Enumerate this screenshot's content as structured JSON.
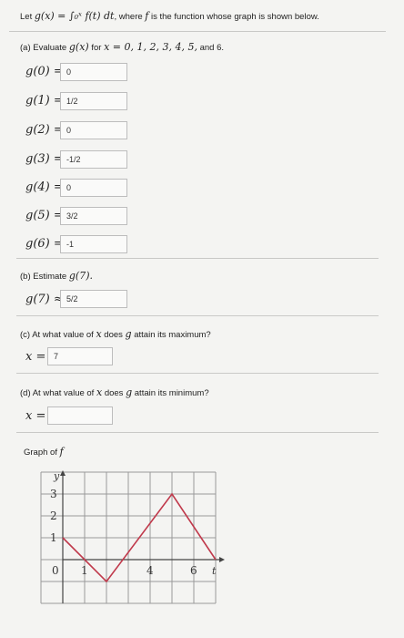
{
  "question": {
    "prefix": "Let",
    "formula": "g(x) = ∫₀ˣ f(t) dt",
    "suffix_pre": ", where",
    "suffix_f": "f",
    "suffix_post": "is the function whose graph is shown below."
  },
  "part_a": {
    "label": "(a) Evaluate",
    "expr": "g(x)",
    "for_text": "for",
    "values_text": "x = 0, 1, 2, 3, 4, 5,",
    "and_text": "and 6.",
    "rows": [
      {
        "label": "g(0) =",
        "answer": "0"
      },
      {
        "label": "g(1) =",
        "answer": "1/2"
      },
      {
        "label": "g(2) =",
        "answer": "0"
      },
      {
        "label": "g(3) =",
        "answer": "-1/2"
      },
      {
        "label": "g(4) =",
        "answer": "0"
      },
      {
        "label": "g(5) =",
        "answer": "3/2"
      },
      {
        "label": "g(6) =",
        "answer": "-1"
      }
    ]
  },
  "part_b": {
    "label": "(b) Estimate",
    "expr": "g(7).",
    "row_label": "g(7) ≈",
    "answer": "5/2"
  },
  "part_c": {
    "text_pre": "(c) At what value of",
    "x": "x",
    "text_mid": "does",
    "g": "g",
    "text_post": "attain its maximum?",
    "row_label": "x =",
    "answer": "7"
  },
  "part_d": {
    "text_pre": "(d) At what value of",
    "x": "x",
    "text_mid": "does",
    "g": "g",
    "text_post": "attain its minimum?",
    "row_label": "x =",
    "answer": ""
  },
  "graph": {
    "title": "Graph of",
    "title_f": "f",
    "y_axis_label": "y",
    "t_axis_label": "t",
    "y_ticks": [
      "3",
      "2",
      "1"
    ],
    "x_ticks": [
      "0",
      "1",
      "4",
      "6"
    ],
    "x_range": [
      -1,
      7
    ],
    "y_range": [
      -2,
      4
    ],
    "curve_color": "#c0394b",
    "curve_points": [
      [
        0,
        1
      ],
      [
        2,
        -1
      ],
      [
        5,
        3
      ],
      [
        7,
        0
      ]
    ]
  }
}
